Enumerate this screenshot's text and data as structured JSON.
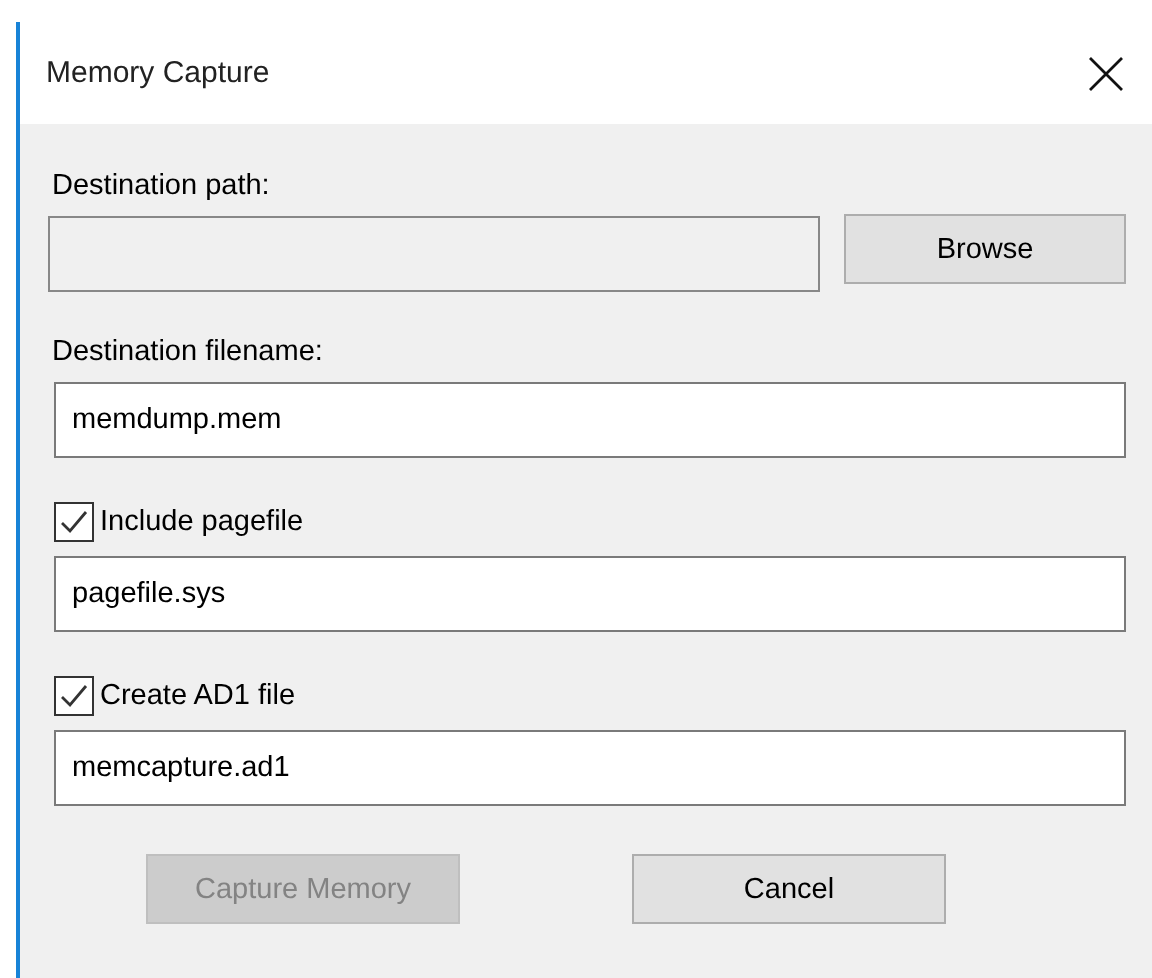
{
  "window": {
    "title": "Memory Capture"
  },
  "destination_path": {
    "label": "Destination path:",
    "disabled": true,
    "browse_button": "Browse"
  },
  "destination_filename": {
    "label": "Destination filename:",
    "value": "memdump.mem"
  },
  "options": [
    {
      "label": "Include pagefile",
      "checked": true,
      "value": "pagefile.sys"
    },
    {
      "label": "Create AD1 file",
      "checked": true,
      "value": "memcapture.ad1"
    }
  ],
  "buttons": [
    {
      "label": "Capture Memory",
      "disabled": true
    },
    {
      "label": "Cancel",
      "disabled": false
    }
  ]
}
